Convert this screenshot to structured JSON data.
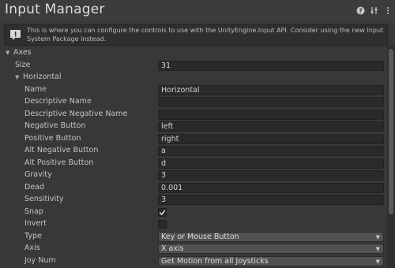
{
  "window": {
    "title": "Input Manager",
    "icons": [
      "help-icon",
      "settings-sliders-icon",
      "more-vertical-icon"
    ]
  },
  "help": {
    "icon": "info-icon",
    "text": "This is where you can configure the controls to use with the UnityEngine.Input API. Consider using the new Input System Package instead."
  },
  "axes": {
    "label": "Axes",
    "size_label": "Size",
    "size_value": "31",
    "item": {
      "label": "Horizontal",
      "rows": [
        {
          "label": "Name",
          "kind": "text",
          "value": "Horizontal"
        },
        {
          "label": "Descriptive Name",
          "kind": "text",
          "value": ""
        },
        {
          "label": "Descriptive Negative Name",
          "kind": "text",
          "value": ""
        },
        {
          "label": "Negative Button",
          "kind": "text",
          "value": "left"
        },
        {
          "label": "Positive Button",
          "kind": "text",
          "value": "right"
        },
        {
          "label": "Alt Negative Button",
          "kind": "text",
          "value": "a"
        },
        {
          "label": "Alt Positive Button",
          "kind": "text",
          "value": "d"
        },
        {
          "label": "Gravity",
          "kind": "text",
          "value": "3"
        },
        {
          "label": "Dead",
          "kind": "text",
          "value": "0.001"
        },
        {
          "label": "Sensitivity",
          "kind": "text",
          "value": "3"
        },
        {
          "label": "Snap",
          "kind": "checkbox",
          "checked": true
        },
        {
          "label": "Invert",
          "kind": "checkbox",
          "checked": false
        },
        {
          "label": "Type",
          "kind": "dropdown",
          "value": "Key or Mouse Button"
        },
        {
          "label": "Axis",
          "kind": "dropdown",
          "value": "X axis"
        },
        {
          "label": "Joy Num",
          "kind": "dropdown",
          "value": "Get Motion from all Joysticks"
        }
      ]
    }
  },
  "colors": {
    "background": "#383838",
    "field": "#2a2a2a",
    "dropdown": "#515151",
    "text": "#c4c4c4"
  }
}
